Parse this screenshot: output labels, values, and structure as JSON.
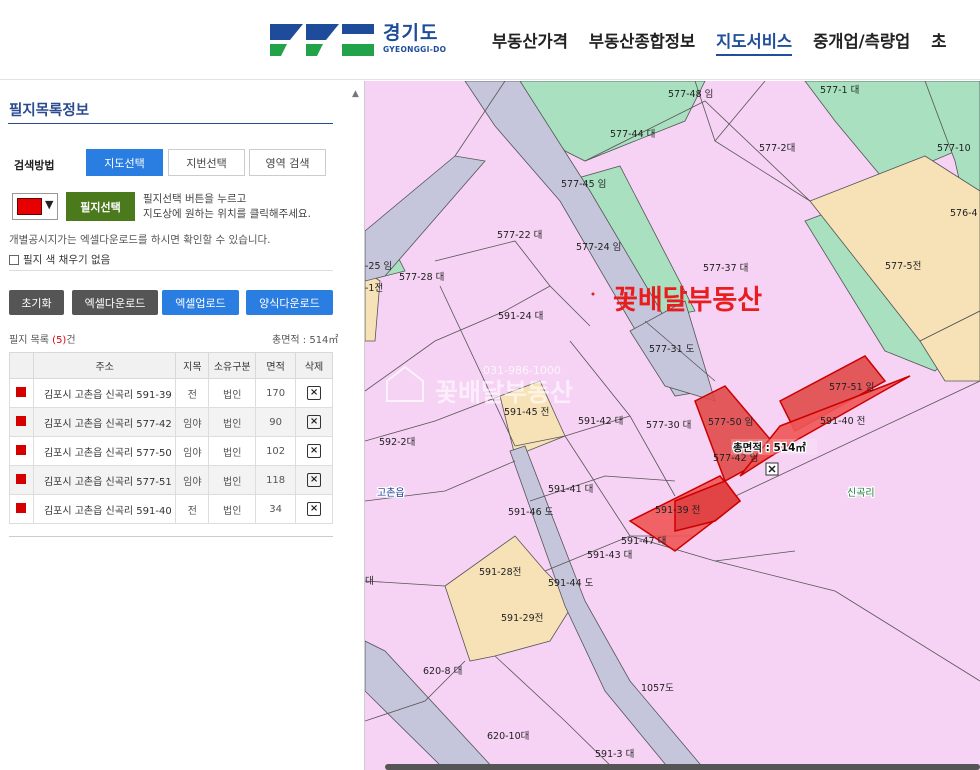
{
  "header": {
    "logo_ko": "경기도",
    "logo_en": "GYEONGGI-DO",
    "nav": [
      "부동산가격",
      "부동산종합정보",
      "지도서비스",
      "중개업/측량업",
      "초"
    ],
    "active_nav": "지도서비스"
  },
  "panel": {
    "title": "필지목록정보",
    "search_method_label": "검색방법",
    "tabs": [
      "지도선택",
      "지번선택",
      "영역 검색"
    ],
    "active_tab": "지도선택",
    "color_swatch": "#e60000",
    "select_button": "필지선택",
    "select_help_line1": "필지선택 버튼을 누르고",
    "select_help_line2": "지도상에 원하는 위치를 클릭해주세요.",
    "excel_note": "개별공시지가는 엑셀다운로드를 하시면 확인할 수 있습니다.",
    "fill_checkbox_label": "필지 색 채우기 없음",
    "fill_checkbox_checked": false,
    "action_buttons": [
      "초기화",
      "엑셀다운로드",
      "엑셀업로드",
      "양식다운로드"
    ],
    "list_label": "필지 목록",
    "list_count": "(5)",
    "list_suffix": "건",
    "total_area": "총면적 : 514㎡",
    "table": {
      "headers": [
        "주소",
        "지목",
        "소유구분",
        "면적",
        "삭제"
      ],
      "rows": [
        {
          "address": "김포시 고촌읍 신곡리 591-39",
          "jimok": "전",
          "owner": "법인",
          "area": "170"
        },
        {
          "address": "김포시 고촌읍 신곡리 577-42",
          "jimok": "임야",
          "owner": "법인",
          "area": "90"
        },
        {
          "address": "김포시 고촌읍 신곡리 577-50",
          "jimok": "임야",
          "owner": "법인",
          "area": "102"
        },
        {
          "address": "김포시 고촌읍 신곡리 577-51",
          "jimok": "임야",
          "owner": "법인",
          "area": "118"
        },
        {
          "address": "김포시 고촌읍 신곡리 591-40",
          "jimok": "전",
          "owner": "법인",
          "area": "34"
        }
      ]
    }
  },
  "map": {
    "watermark_red": "꽃배달부동산",
    "watermark_phone": "031-986-1000",
    "watermark_faded": "꽃배달부동산",
    "total_area_label": "총면적 : 514㎡",
    "place_labels": [
      "고촌읍",
      "신곡리"
    ],
    "parcel_labels": [
      "577-48 임",
      "577-1 대",
      "577-44 대",
      "577-2대",
      "577-10",
      "577-45 임",
      "576-4",
      "577-22 대",
      "577-24 임",
      "-25 임",
      "577-28 대",
      "-1전",
      "577-37 대",
      "577-5전",
      "591-24 대",
      "577-31 도",
      "577-51 임",
      "591-45 전",
      "591-42 대",
      "577-30 대",
      "577-50 임",
      "577-42 임",
      "591-40 전",
      "592-2대",
      "591-41 대",
      "591-46 도",
      "591-39 전",
      "591-47 대",
      "591-43 대",
      "591-28전",
      "591-44 도",
      "591-29전",
      "대",
      "620-8 대",
      "1057도",
      "620-10대",
      "591-3 대"
    ],
    "colors": {
      "residential": "#f6d2f4",
      "forest": "#a8e0c0",
      "field": "#f7e2b8",
      "road": "#c5c6dc",
      "highlight": "#f04040"
    }
  }
}
